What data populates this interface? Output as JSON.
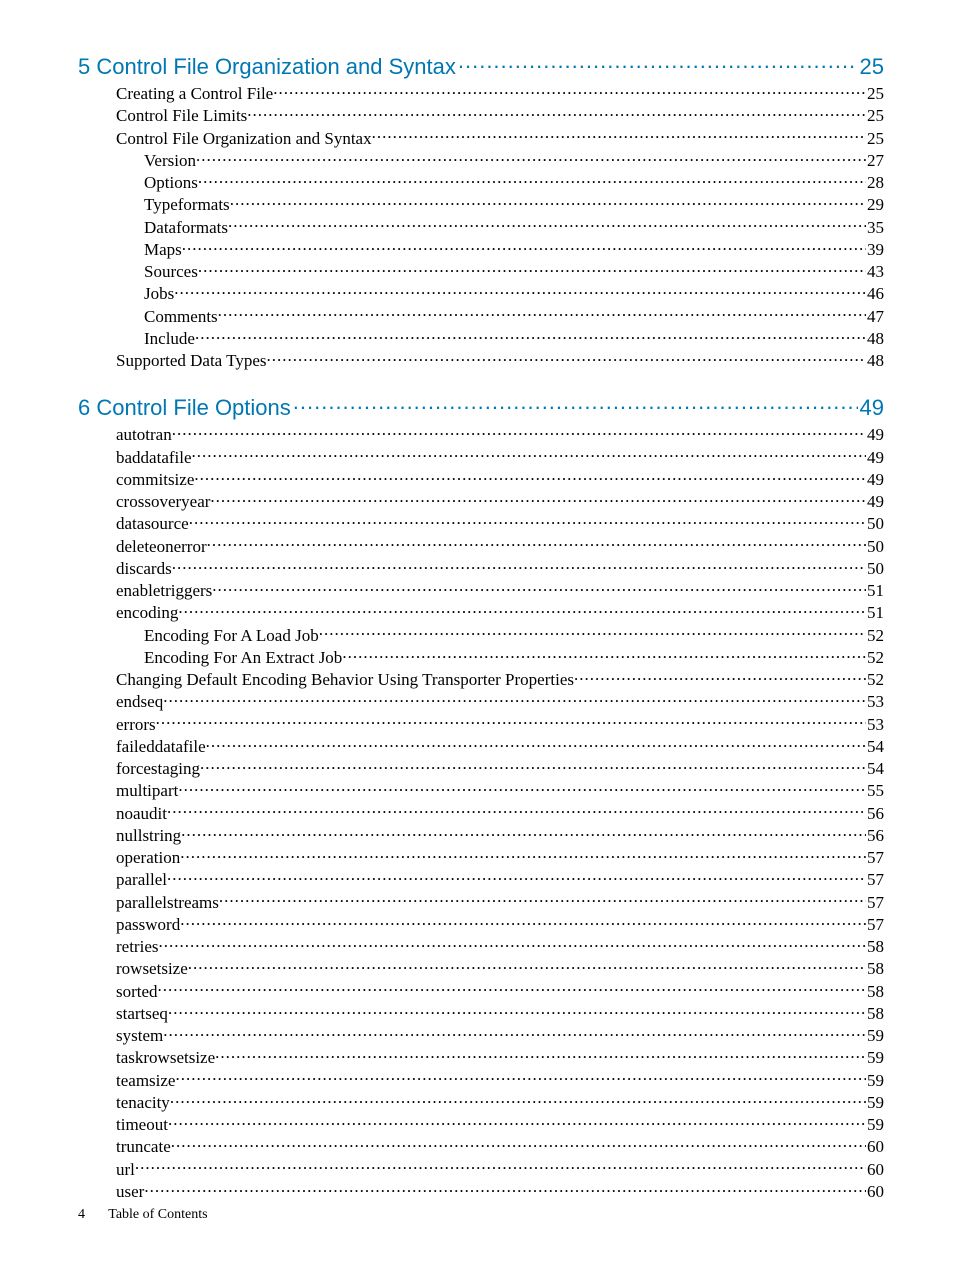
{
  "sections": [
    {
      "num": "5",
      "title": "Control File Organization and Syntax",
      "page": "25",
      "entries": [
        {
          "t": "Creating a Control File",
          "p": "25",
          "i": 1
        },
        {
          "t": "Control File Limits",
          "p": "25",
          "i": 1
        },
        {
          "t": "Control File Organization and Syntax",
          "p": "25",
          "i": 1
        },
        {
          "t": "Version",
          "p": "27",
          "i": 2
        },
        {
          "t": "Options",
          "p": "28",
          "i": 2
        },
        {
          "t": "Typeformats",
          "p": "29",
          "i": 2
        },
        {
          "t": "Dataformats",
          "p": "35",
          "i": 2
        },
        {
          "t": "Maps",
          "p": "39",
          "i": 2
        },
        {
          "t": "Sources",
          "p": "43",
          "i": 2
        },
        {
          "t": "Jobs",
          "p": "46",
          "i": 2
        },
        {
          "t": "Comments",
          "p": "47",
          "i": 2
        },
        {
          "t": "Include",
          "p": "48",
          "i": 2
        },
        {
          "t": "Supported Data Types",
          "p": "48",
          "i": 1
        }
      ]
    },
    {
      "num": "6",
      "title": "Control File Options",
      "page": "49",
      "entries": [
        {
          "t": "autotran",
          "p": "49",
          "i": 1
        },
        {
          "t": "baddatafile",
          "p": "49",
          "i": 1
        },
        {
          "t": "commitsize",
          "p": "49",
          "i": 1
        },
        {
          "t": "crossoveryear",
          "p": "49",
          "i": 1
        },
        {
          "t": "datasource",
          "p": "50",
          "i": 1
        },
        {
          "t": "deleteonerror",
          "p": "50",
          "i": 1
        },
        {
          "t": "discards",
          "p": "50",
          "i": 1
        },
        {
          "t": "enabletriggers",
          "p": "51",
          "i": 1
        },
        {
          "t": "encoding",
          "p": "51",
          "i": 1
        },
        {
          "t": "Encoding For A Load Job",
          "p": "52",
          "i": 2
        },
        {
          "t": "Encoding For An Extract Job",
          "p": "52",
          "i": 2
        },
        {
          "t": "Changing Default Encoding Behavior Using Transporter Properties",
          "p": "52",
          "i": 1
        },
        {
          "t": "endseq",
          "p": "53",
          "i": 1
        },
        {
          "t": "errors",
          "p": "53",
          "i": 1
        },
        {
          "t": "faileddatafile",
          "p": "54",
          "i": 1
        },
        {
          "t": "forcestaging",
          "p": "54",
          "i": 1
        },
        {
          "t": "multipart",
          "p": "55",
          "i": 1
        },
        {
          "t": "noaudit",
          "p": "56",
          "i": 1
        },
        {
          "t": "nullstring",
          "p": "56",
          "i": 1
        },
        {
          "t": "operation",
          "p": "57",
          "i": 1
        },
        {
          "t": "parallel",
          "p": "57",
          "i": 1
        },
        {
          "t": "parallelstreams",
          "p": "57",
          "i": 1
        },
        {
          "t": "password",
          "p": "57",
          "i": 1
        },
        {
          "t": "retries",
          "p": "58",
          "i": 1
        },
        {
          "t": "rowsetsize",
          "p": "58",
          "i": 1
        },
        {
          "t": "sorted",
          "p": "58",
          "i": 1
        },
        {
          "t": "startseq",
          "p": "58",
          "i": 1
        },
        {
          "t": "system",
          "p": "59",
          "i": 1
        },
        {
          "t": "taskrowsetsize",
          "p": "59",
          "i": 1
        },
        {
          "t": "teamsize",
          "p": "59",
          "i": 1
        },
        {
          "t": "tenacity",
          "p": "59",
          "i": 1
        },
        {
          "t": "timeout",
          "p": "59",
          "i": 1
        },
        {
          "t": "truncate",
          "p": "60",
          "i": 1
        },
        {
          "t": "url",
          "p": "60",
          "i": 1
        },
        {
          "t": "user",
          "p": "60",
          "i": 1
        }
      ]
    }
  ],
  "footer": {
    "page_number": "4",
    "label": "Table of Contents"
  }
}
